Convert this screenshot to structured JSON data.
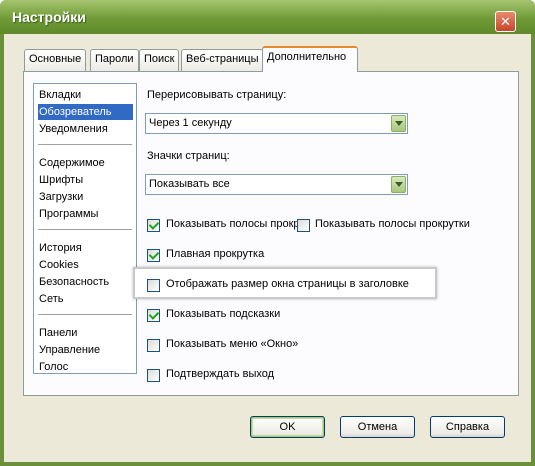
{
  "window": {
    "title": "Настройки",
    "close_glyph": "✕"
  },
  "tabs": [
    {
      "label": "Основные",
      "active": false
    },
    {
      "label": "Пароли",
      "active": false
    },
    {
      "label": "Поиск",
      "active": false
    },
    {
      "label": "Веб-страницы",
      "active": false
    },
    {
      "label": "Дополнительно",
      "active": true
    }
  ],
  "sidebar": {
    "selected": "Обозреватель",
    "groups": [
      [
        "Вкладки",
        "Обозреватель",
        "Уведомления"
      ],
      [
        "Содержимое",
        "Шрифты",
        "Загрузки",
        "Программы"
      ],
      [
        "История",
        "Cookies",
        "Безопасность",
        "Сеть"
      ],
      [
        "Панели",
        "Управление",
        "Голос"
      ]
    ]
  },
  "settings": {
    "redraw_label": "Перерисовывать страницу:",
    "redraw_value": "Через 1 секунду",
    "icons_label": "Значки страниц:",
    "icons_value": "Показывать все",
    "checkboxes": [
      {
        "label": "Показывать полосы прокр",
        "checked": true
      },
      {
        "label": "Показывать полосы прокрутки",
        "checked": false
      },
      {
        "label": "Плавная прокрутка",
        "checked": true
      },
      {
        "label": "Отображать размер окна страницы в заголовке",
        "checked": false
      },
      {
        "label": "Показывать подсказки",
        "checked": true
      },
      {
        "label": "Показывать меню «Окно»",
        "checked": false
      },
      {
        "label": "Подтверждать выход",
        "checked": false
      }
    ]
  },
  "buttons": {
    "ok": "OK",
    "cancel": "Отмена",
    "help": "Справка"
  },
  "colors": {
    "accent": "#e68b2c",
    "selection": "#316ac5",
    "titlebar": "#6f9a36"
  }
}
